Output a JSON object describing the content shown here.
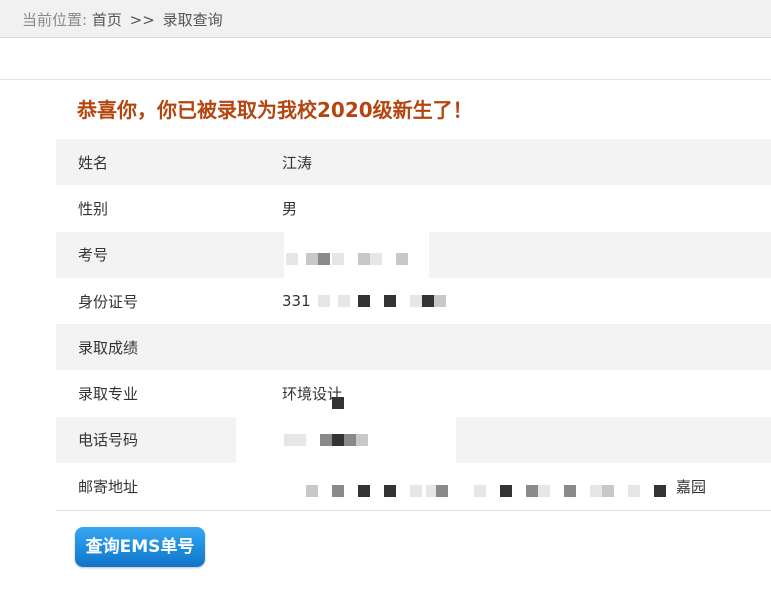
{
  "breadcrumb": {
    "current_label": "当前位置:",
    "home": "首页",
    "separator": ">>",
    "page": "录取查询"
  },
  "headline": "恭喜你，你已被录取为我校2020级新生了！",
  "rows": [
    {
      "label": "姓名",
      "value": "江涛"
    },
    {
      "label": "性别",
      "value": "男"
    },
    {
      "label": "考号",
      "value": ""
    },
    {
      "label": "身份证号",
      "value": "331"
    },
    {
      "label": "录取成绩",
      "value": ""
    },
    {
      "label": "录取专业",
      "value": "环境设计"
    },
    {
      "label": "电话号码",
      "value": ""
    },
    {
      "label": "邮寄地址",
      "value": "嘉园"
    }
  ],
  "ems_button_label": "查询EMS单号",
  "colors": {
    "headline": "#b5450f",
    "row_shade": "#f3f3f3",
    "button": "#1e8fe0"
  }
}
